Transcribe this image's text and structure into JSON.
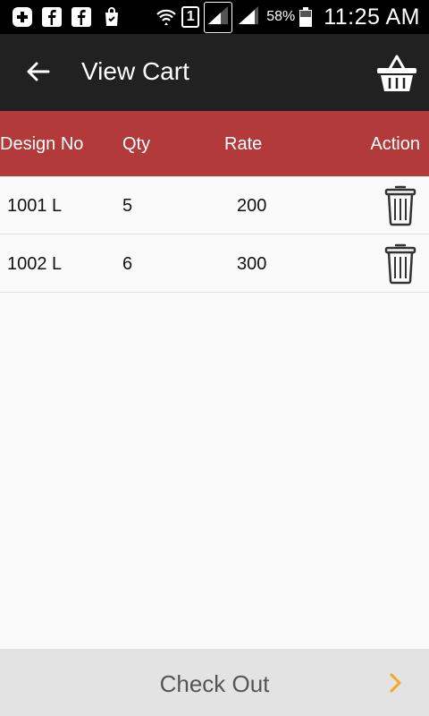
{
  "status_bar": {
    "notif_box_text": "1",
    "battery_percent": "58%",
    "battery_level": 0.58,
    "time": "11:25 AM",
    "icons": [
      "plus-box-icon",
      "facebook-icon",
      "facebook-icon",
      "shopping-bag-icon",
      "wifi-icon",
      "sim-1-icon",
      "signal-icon",
      "signal-icon",
      "battery-icon"
    ]
  },
  "app_bar": {
    "title": "View Cart",
    "back_icon": "arrow-left-icon",
    "cart_icon": "basket-icon"
  },
  "table": {
    "headers": {
      "design_no": "Design No",
      "qty": "Qty",
      "rate": "Rate",
      "action": "Action"
    },
    "rows": [
      {
        "design_no": "1001 L",
        "qty": "5",
        "rate": "200",
        "action_icon": "trash-icon"
      },
      {
        "design_no": "1002 L",
        "qty": "6",
        "rate": "300",
        "action_icon": "trash-icon"
      }
    ]
  },
  "checkout": {
    "label": "Check Out",
    "icon": "chevron-right-icon"
  },
  "colors": {
    "status_bar_bg": "#000000",
    "app_bar_bg": "#212121",
    "header_bg": "#b23a3a",
    "page_bg": "#fafafa",
    "checkout_bg": "#e3e3e3",
    "accent": "#f5a623"
  }
}
